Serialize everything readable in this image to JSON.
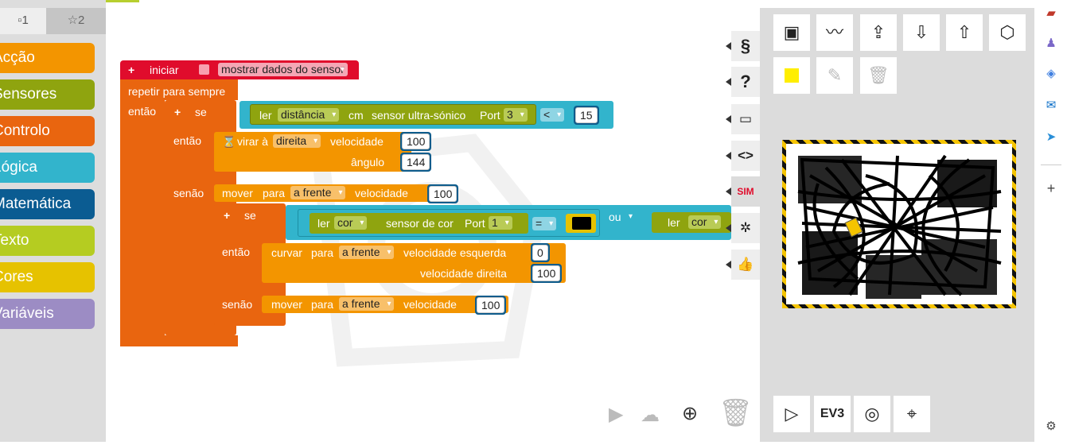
{
  "toolbox": {
    "tabs": [
      "▫1",
      "☆2"
    ],
    "categories": [
      {
        "label": "Acção",
        "color": "#f39500"
      },
      {
        "label": "Sensores",
        "color": "#8fa40f"
      },
      {
        "label": "Controlo",
        "color": "#e9650f"
      },
      {
        "label": "Lógica",
        "color": "#32b4cc"
      },
      {
        "label": "Matemática",
        "color": "#0b5c92"
      },
      {
        "label": "Texto",
        "color": "#b5cc21"
      },
      {
        "label": "Cores",
        "color": "#e6c200"
      },
      {
        "label": "Variáveis",
        "color": "#9c8cc4"
      }
    ]
  },
  "program": {
    "start": {
      "label": "iniciar",
      "checkbox_label": "mostrar dados do sensor"
    },
    "loop": {
      "label": "repetir para sempre",
      "do_label": "então"
    },
    "if1": {
      "label": "se",
      "then_label": "então",
      "else_label": "senão"
    },
    "cond1": {
      "read_label": "ler",
      "mode": "distância",
      "unit": "cm",
      "sensor": "sensor ultra-sónico",
      "port_label": "Port",
      "port": "3",
      "op": "<",
      "value": "15"
    },
    "turn": {
      "label": "virar à",
      "direction": "direita",
      "speed_label": "velocidade",
      "speed": "100",
      "angle_label": "ângulo",
      "angle": "144"
    },
    "move1": {
      "label": "mover",
      "para": "para",
      "direction": "a frente",
      "speed_label": "velocidade",
      "speed": "100"
    },
    "if2": {
      "label": "se",
      "then_label": "então",
      "else_label": "senão"
    },
    "cond2": {
      "read_label": "ler",
      "mode": "cor",
      "sensor": "sensor de cor",
      "port_label": "Port",
      "port": "1",
      "op": "=",
      "color_value": "#000000",
      "or_label": "ou",
      "read2_label": "ler",
      "mode2": "cor"
    },
    "curve": {
      "label": "curvar",
      "para": "para",
      "direction": "a frente",
      "left_label": "velocidade  esquerda",
      "left": "0",
      "right_label": "velocidade  direita",
      "right": "100"
    },
    "move2": {
      "label": "mover",
      "para": "para",
      "direction": "a frente",
      "speed_label": "velocidade",
      "speed": "100"
    }
  },
  "side_tabs": [
    {
      "name": "source-code-tab",
      "glyph": "§"
    },
    {
      "name": "help-tab",
      "glyph": "?"
    },
    {
      "name": "comment-tab",
      "glyph": "▭"
    },
    {
      "name": "code-view-tab",
      "glyph": "<>"
    },
    {
      "name": "sim-tab",
      "glyph": "SIM"
    },
    {
      "name": "debug-tab",
      "glyph": "✲"
    },
    {
      "name": "feedback-tab",
      "glyph": "👍"
    }
  ],
  "sim": {
    "robot_color": "#f5c400",
    "selected_color": "#ffee00",
    "controls": [
      "▷",
      "EV3",
      "◎",
      "⌖"
    ]
  }
}
